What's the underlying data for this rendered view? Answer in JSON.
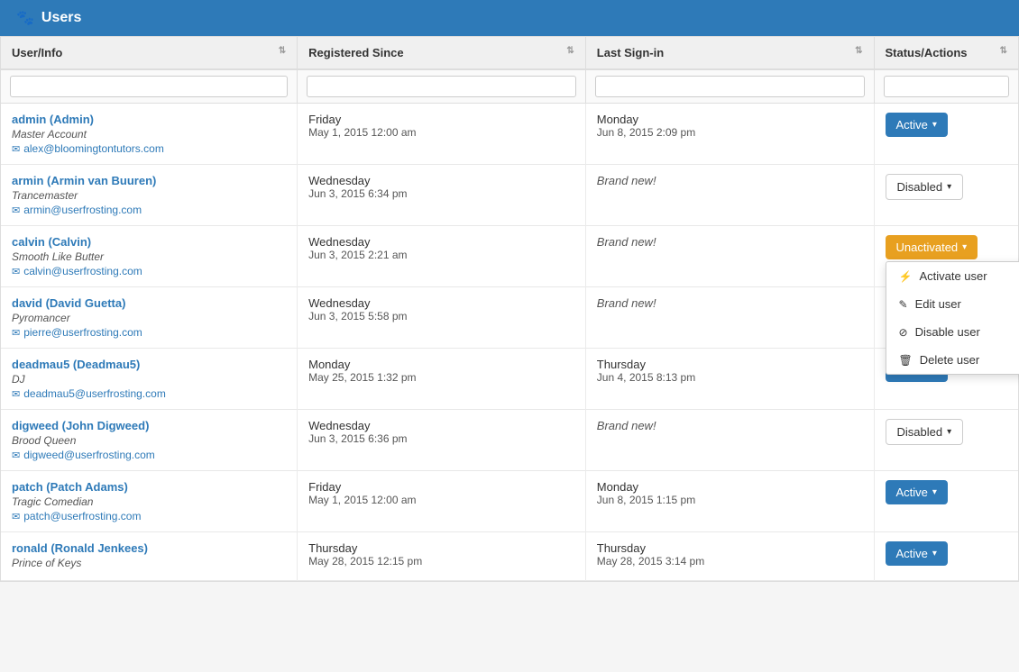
{
  "header": {
    "icon": "🐾",
    "title": "Users"
  },
  "table": {
    "columns": [
      {
        "id": "user-info",
        "label": "User/Info",
        "sortable": true
      },
      {
        "id": "registered-since",
        "label": "Registered Since",
        "sortable": true
      },
      {
        "id": "last-sign-in",
        "label": "Last Sign-in",
        "sortable": true
      },
      {
        "id": "status-actions",
        "label": "Status/Actions",
        "sortable": true
      }
    ],
    "filters": {
      "user_info_placeholder": "",
      "registered_placeholder": "",
      "last_signin_placeholder": "",
      "status_placeholder": ""
    },
    "rows": [
      {
        "username": "admin (Admin)",
        "title": "Master Account",
        "email": "alex@bloomingtontutors.com",
        "registered_day": "Friday",
        "registered_date": "May 1, 2015 12:00 am",
        "last_signin_day": "Monday",
        "last_signin_date": "Jun 8, 2015 2:09 pm",
        "status": "Active",
        "status_type": "active"
      },
      {
        "username": "armin (Armin van Buuren)",
        "title": "Trancemaster",
        "email": "armin@userfrosting.com",
        "registered_day": "Wednesday",
        "registered_date": "Jun 3, 2015 6:34 pm",
        "last_signin_day": "",
        "last_signin_date": "Brand new!",
        "status": "Disabled",
        "status_type": "disabled"
      },
      {
        "username": "calvin (Calvin)",
        "title": "Smooth Like Butter",
        "email": "calvin@userfrosting.com",
        "registered_day": "Wednesday",
        "registered_date": "Jun 3, 2015 2:21 am",
        "last_signin_day": "",
        "last_signin_date": "Brand new!",
        "status": "Unactivated",
        "status_type": "unactivated",
        "dropdown_open": true
      },
      {
        "username": "david (David Guetta)",
        "title": "Pyromancer",
        "email": "pierre@userfrosting.com",
        "registered_day": "Wednesday",
        "registered_date": "Jun 3, 2015 5:58 pm",
        "last_signin_day": "",
        "last_signin_date": "Brand new!",
        "status": "",
        "status_type": "none"
      },
      {
        "username": "deadmau5 (Deadmau5)",
        "title": "DJ",
        "email": "deadmau5@userfrosting.com",
        "registered_day": "Monday",
        "registered_date": "May 25, 2015 1:32 pm",
        "last_signin_day": "Thursday",
        "last_signin_date": "Jun 4, 2015 8:13 pm",
        "status": "Active",
        "status_type": "active"
      },
      {
        "username": "digweed (John Digweed)",
        "title": "Brood Queen",
        "email": "digweed@userfrosting.com",
        "registered_day": "Wednesday",
        "registered_date": "Jun 3, 2015 6:36 pm",
        "last_signin_day": "",
        "last_signin_date": "Brand new!",
        "status": "Disabled",
        "status_type": "disabled"
      },
      {
        "username": "patch (Patch Adams)",
        "title": "Tragic Comedian",
        "email": "patch@userfrosting.com",
        "registered_day": "Friday",
        "registered_date": "May 1, 2015 12:00 am",
        "last_signin_day": "Monday",
        "last_signin_date": "Jun 8, 2015 1:15 pm",
        "status": "Active",
        "status_type": "active"
      },
      {
        "username": "ronald (Ronald Jenkees)",
        "title": "Prince of Keys",
        "email": "",
        "registered_day": "Thursday",
        "registered_date": "May 28, 2015 12:15 pm",
        "last_signin_day": "Thursday",
        "last_signin_date": "May 28, 2015 3:14 pm",
        "status": "Active",
        "status_type": "active"
      }
    ],
    "dropdown_menu": {
      "items": [
        {
          "id": "activate-user",
          "icon": "⚡",
          "label": "Activate user"
        },
        {
          "id": "edit-user",
          "icon": "✎",
          "label": "Edit user"
        },
        {
          "id": "disable-user",
          "icon": "⊘",
          "label": "Disable user"
        },
        {
          "id": "delete-user",
          "icon": "🗑",
          "label": "Delete user"
        }
      ]
    }
  }
}
